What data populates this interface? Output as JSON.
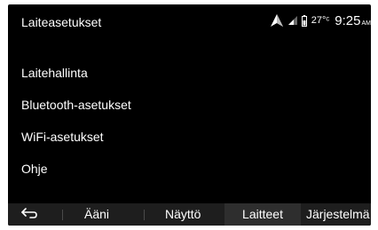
{
  "header": {
    "title": "Laiteasetukset",
    "status": {
      "icons": [
        "navigation-arrow-icon",
        "signal-strength-icon",
        "phone-battery-icon"
      ],
      "temperature": "27°ᶜ",
      "time": "9:25",
      "ampm": "AM"
    }
  },
  "menu": {
    "items": [
      {
        "label": "Laitehallinta"
      },
      {
        "label": "Bluetooth-asetukset"
      },
      {
        "label": "WiFi-asetukset"
      },
      {
        "label": "Ohje"
      }
    ]
  },
  "bottom_bar": {
    "back_icon": "back-arrow-icon",
    "tabs": [
      {
        "label": "Ääni",
        "active": false
      },
      {
        "label": "Näyttö",
        "active": false
      },
      {
        "label": "Laitteet",
        "active": true
      },
      {
        "label": "Järjestelmä",
        "active": false
      }
    ]
  },
  "colors": {
    "background": "#000000",
    "text": "#ffffff",
    "bar": "#1e1e1e",
    "active_tab": "#2e2e2e"
  }
}
